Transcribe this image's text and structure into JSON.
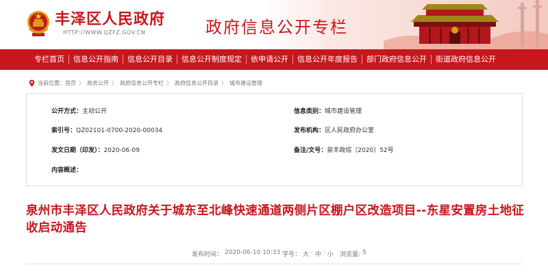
{
  "header": {
    "site_name": "丰泽区人民政府",
    "site_url": "HTTP://WWW.QZFZ.GOV.CN",
    "column_title": "政府信息公开专栏",
    "brand_color": "#c8161d"
  },
  "nav": {
    "items": [
      {
        "label": "专栏首页"
      },
      {
        "label": "信息公开指南"
      },
      {
        "label": "信息公开目录"
      },
      {
        "label": "信息公开制度规定"
      },
      {
        "label": "依申请公开"
      },
      {
        "label": "信息公开年度报告"
      },
      {
        "label": "部门政府信息公开"
      },
      {
        "label": "街道政府信息公开"
      }
    ]
  },
  "breadcrumb": {
    "prefix": "当前位置：",
    "items": [
      "首页",
      "政务公开",
      "政府信息公开专栏",
      "政府信息公开目录",
      "城市建设管理"
    ],
    "separator": "〉"
  },
  "info": {
    "open_method_label": "公开方式：",
    "open_method": "主动公开",
    "category_label": "信息类别：",
    "category": "城市建设管理",
    "index_label": "索引号：",
    "index": "QZ02101-0700-2020-00034",
    "publisher_label": "发布机构：",
    "publisher": "区人民政府办公室",
    "date_label": "发文日期（印发）：",
    "date": "2020-06-09",
    "doc_no_label": "备注/文号：",
    "doc_no": "泉丰政综〔2020〕52号",
    "summary_label": "内容概述："
  },
  "article": {
    "title": "泉州市丰泽区人民政府关于城东至北峰快速通道两侧片区棚户区改造项目--东星安置房土地征收启动通告"
  },
  "meta": {
    "publish_label": "发布时间：",
    "publish_time": "2020-06-10 10:33",
    "font_label": "字号：",
    "size_large": "大",
    "size_medium": "中",
    "size_small": "小",
    "views_label": "浏览量:",
    "views": "5",
    "dot": "·"
  }
}
